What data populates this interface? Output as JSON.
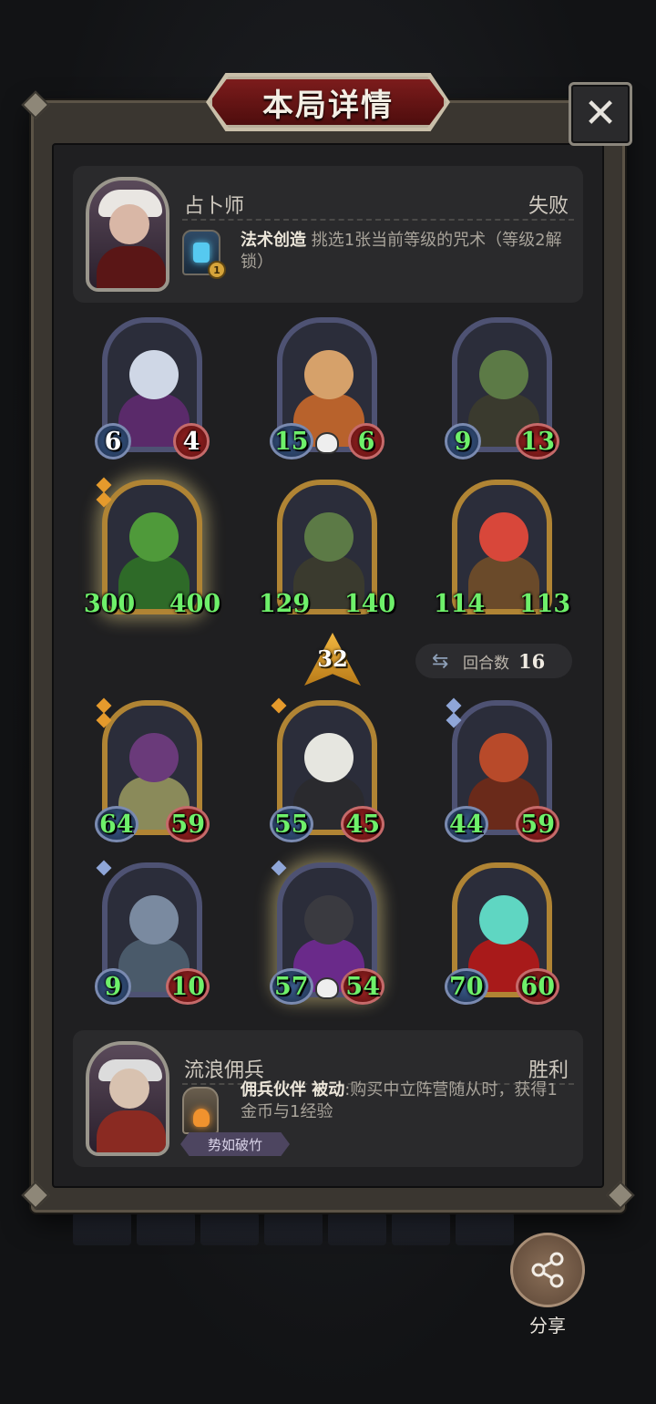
{
  "title": "本局详情",
  "close_label": "✕",
  "players": [
    {
      "name": "占卜师",
      "result": "失败",
      "power_name": "法术创造",
      "power_tag": "",
      "power_desc": " 挑选1张当前等级的咒术（等级2解锁）",
      "power_cost": "1",
      "badge": ""
    },
    {
      "name": "流浪佣兵",
      "result": "胜利",
      "power_name": "佣兵伙伴",
      "power_tag": " 被动",
      "power_desc": ":购买中立阵营随从时，获得1金币与1经验",
      "power_cost": "",
      "badge": "势如破竹"
    }
  ],
  "top_board": [
    {
      "attack": "6",
      "health": "4",
      "frame": "blue",
      "buffed": false,
      "skull": false,
      "glow": false,
      "gems": 0,
      "head": "#cfd7e6",
      "torso": "#5a2a6a"
    },
    {
      "attack": "15",
      "health": "6",
      "frame": "blue",
      "buffed": true,
      "skull": true,
      "glow": false,
      "gems": 0,
      "head": "#d6a16a",
      "torso": "#b8622c"
    },
    {
      "attack": "9",
      "health": "13",
      "frame": "blue",
      "buffed": true,
      "skull": false,
      "glow": false,
      "gems": 0,
      "head": "#5c7a46",
      "torso": "#3a3a2e"
    },
    {
      "attack": "300",
      "health": "400",
      "frame": "gold",
      "buffed": true,
      "skull": false,
      "glow": true,
      "gems": 2,
      "head": "#4f9a3a",
      "torso": "#2e6a28"
    },
    {
      "attack": "129",
      "health": "140",
      "frame": "gold",
      "buffed": true,
      "skull": false,
      "glow": false,
      "gems": 0,
      "head": "#5c7a46",
      "torso": "#3a3a2e"
    },
    {
      "attack": "114",
      "health": "113",
      "frame": "gold",
      "buffed": true,
      "skull": false,
      "glow": false,
      "gems": 0,
      "head": "#d8473a",
      "torso": "#6a4a2a"
    }
  ],
  "center": {
    "tier": "32",
    "turns_label": "回合数",
    "turns_value": "16",
    "turns_icon": "swap-icon"
  },
  "bottom_board": [
    {
      "attack": "64",
      "health": "59",
      "frame": "gold",
      "buffed": true,
      "skull": false,
      "glow": false,
      "gems": 2,
      "gem_color": "orange",
      "head": "#6a3a7a",
      "torso": "#8a8a5a"
    },
    {
      "attack": "55",
      "health": "45",
      "frame": "gold",
      "buffed": true,
      "skull": false,
      "glow": false,
      "gems": 1,
      "gem_color": "orange",
      "head": "#e6e6e0",
      "torso": "#2a2a2e"
    },
    {
      "attack": "44",
      "health": "59",
      "frame": "blue",
      "buffed": true,
      "skull": false,
      "glow": false,
      "gems": 2,
      "gem_color": "blue",
      "head": "#b84a2a",
      "torso": "#6a2a1a"
    },
    {
      "attack": "9",
      "health": "10",
      "frame": "blue",
      "buffed": true,
      "skull": false,
      "glow": false,
      "gems": 1,
      "gem_color": "blue",
      "head": "#7a8aa0",
      "torso": "#4a5a6a"
    },
    {
      "attack": "57",
      "health": "54",
      "frame": "blue",
      "buffed": true,
      "skull": true,
      "glow": true,
      "gems": 1,
      "gem_color": "blue",
      "head": "#3a3a40",
      "torso": "#6a2a8a"
    },
    {
      "attack": "70",
      "health": "60",
      "frame": "gold",
      "buffed": true,
      "skull": false,
      "glow": false,
      "gems": 0,
      "gem_color": "",
      "head": "#5fd6c2",
      "torso": "#a81a1a"
    }
  ],
  "share_label": "分享",
  "share_icon": "share-icon"
}
